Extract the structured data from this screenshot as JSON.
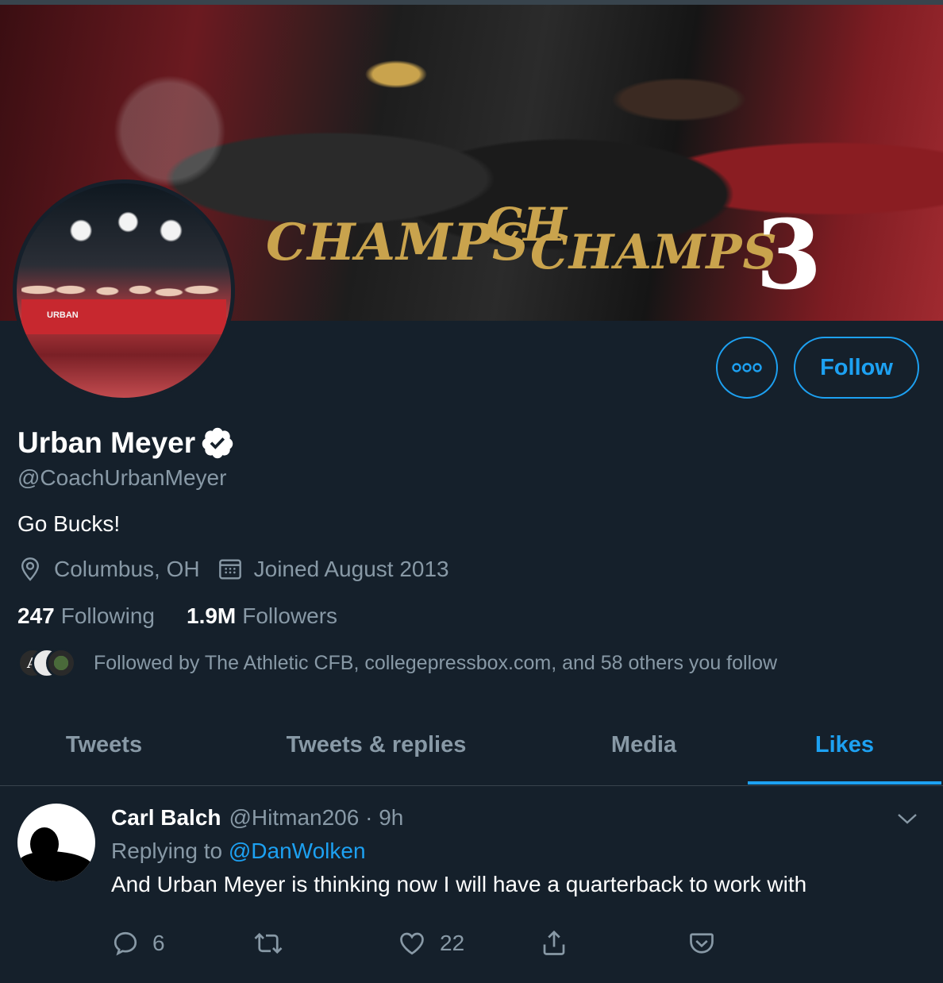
{
  "banner": {
    "shirt_text_1": "CHAMPS",
    "shirt_text_2": "CHAMPS",
    "shirt_text_3": "CH",
    "jersey_number": "3"
  },
  "avatar": {
    "label": "URBAN"
  },
  "actions": {
    "follow_label": "Follow",
    "more_icon": "more-icon"
  },
  "profile": {
    "name": "Urban Meyer",
    "verified_icon": "verified-badge-icon",
    "handle": "@CoachUrbanMeyer",
    "bio": "Go Bucks!",
    "location": "Columbus, OH",
    "joined": "Joined August 2013",
    "following_count": "247",
    "following_label": "Following",
    "followers_count": "1.9M",
    "followers_label": "Followers",
    "followed_by": "Followed by The Athletic CFB, collegepressbox.com, and 58 others you follow",
    "followed_by_avatar_1": "A"
  },
  "tabs": [
    {
      "label": "Tweets"
    },
    {
      "label": "Tweets & replies"
    },
    {
      "label": "Media"
    },
    {
      "label": "Likes"
    }
  ],
  "tweet": {
    "name": "Carl Balch",
    "meta": "@Hitman206 · 9h",
    "replying_prefix": "Replying to",
    "replying_to": "@DanWolken",
    "text": "And Urban Meyer is thinking now I will have a quarterback to work with",
    "reply_count": "6",
    "retweet_count": "",
    "like_count": "22"
  },
  "colors": {
    "background": "#15202b",
    "accent": "#1da1f2",
    "secondary_text": "#8899a6",
    "border": "#38444d"
  }
}
